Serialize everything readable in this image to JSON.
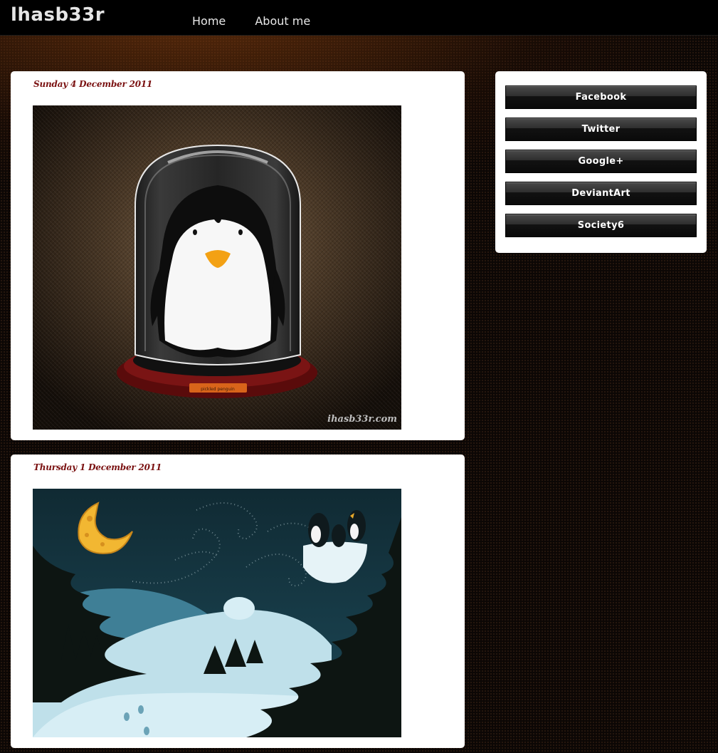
{
  "header": {
    "site_title": "lhasb33r",
    "nav": [
      {
        "label": "Home"
      },
      {
        "label": "About me"
      }
    ]
  },
  "posts": [
    {
      "date": "Sunday 4 December 2011",
      "image": {
        "plaque_text": "pickled penguin",
        "watermark": "ihasb33r.com"
      }
    },
    {
      "date": "Thursday 1 December 2011"
    }
  ],
  "sidebar": {
    "buttons": [
      {
        "label": "Facebook"
      },
      {
        "label": "Twitter"
      },
      {
        "label": "Google+"
      },
      {
        "label": "DeviantArt"
      },
      {
        "label": "Society6"
      }
    ]
  },
  "colors": {
    "page_bg": "#0c0705",
    "topbar_bg": "#000000",
    "date_color": "#7a1111",
    "panel_bg": "#ffffff"
  }
}
